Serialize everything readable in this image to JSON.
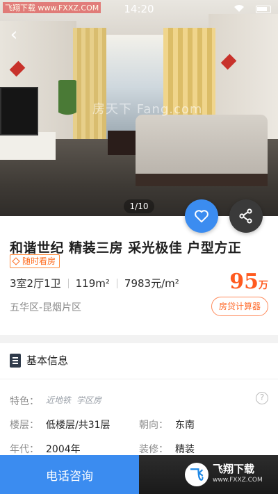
{
  "status_bar": {
    "brand_watermark": "飞翔下载 www.FXXZ.COM",
    "time": "14:20"
  },
  "photo": {
    "watermark": "房天下 Fang.com",
    "counter": "1/10"
  },
  "listing": {
    "title": "和谐世纪 精装三房 采光极佳 户型方正",
    "visit_tag": "随时看房",
    "specs": [
      "3室2厅1卫",
      "119m²",
      "7983元/m²"
    ],
    "price_value": "95",
    "price_unit": "万",
    "region": "五华区-昆烟片区",
    "calc_button": "房贷计算器"
  },
  "basic_info": {
    "heading": "基本信息",
    "feature_label": "特色：",
    "features": [
      "近地铁",
      "学区房"
    ],
    "floor_label": "楼层：",
    "floor_value": "低楼层/共31层",
    "orientation_label": "朝向：",
    "orientation_value": "东南",
    "year_label": "年代：",
    "year_value": "2004年",
    "decoration_label": "装修：",
    "decoration_value": "精装"
  },
  "bottom_bar": {
    "call_button": "电话咨询",
    "logo_badge": "飞",
    "logo_text": "飞翔下载",
    "logo_url": "www.FXXZ.COM"
  },
  "colors": {
    "accent_blue": "#3b8cf0",
    "price_orange": "#ff5a1f",
    "share_dark": "#3a3a3a"
  },
  "icons": {
    "back": "back-arrow-icon",
    "favorite": "heart-icon",
    "share": "share-icon",
    "doc": "document-icon",
    "help": "question-circle-icon"
  }
}
